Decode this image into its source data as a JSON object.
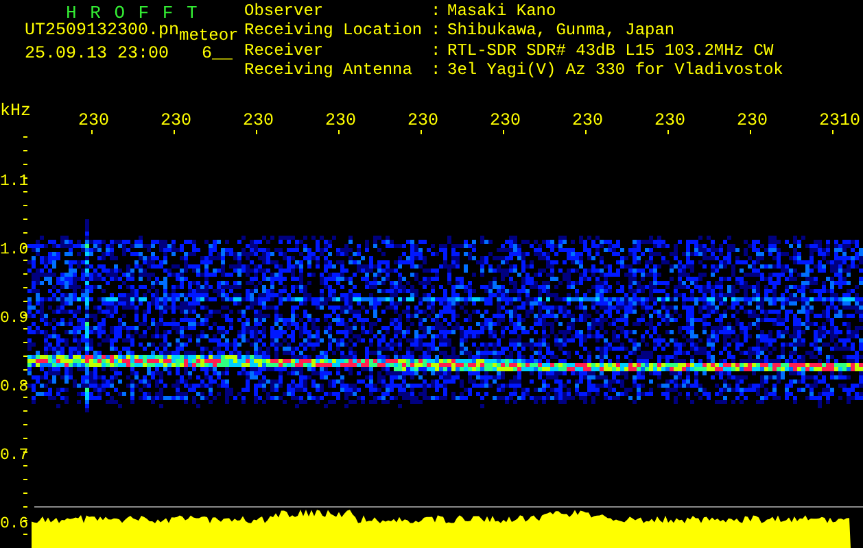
{
  "header": {
    "title": "H R O F F T",
    "file_name": "UT2509132300.pn",
    "file_tag": "meteor",
    "timestamp": "25.09.13 23:00",
    "counter": "6__"
  },
  "station_info": [
    {
      "label": "Observer",
      "separator": ":",
      "value": "Masaki Kano"
    },
    {
      "label": "Receiving Location",
      "separator": ":",
      "value": "Shibukawa, Gunma, Japan"
    },
    {
      "label": "Receiver",
      "separator": ":",
      "value": "RTL-SDR SDR# 43dB L15 103.2MHz CW"
    },
    {
      "label": "Receiving Antenna",
      "separator": ":",
      "value": "3el Yagi(V) Az 330 for Vladivostok"
    }
  ],
  "plot": {
    "y_unit": "kHz",
    "x_labels": [
      "230",
      "230",
      "230",
      "230",
      "230",
      "230",
      "230",
      "230",
      "230",
      "2310"
    ],
    "y_labels": [
      "1.1",
      "1.0",
      "0.9",
      "0.8",
      "0.7",
      "0.6"
    ]
  }
}
